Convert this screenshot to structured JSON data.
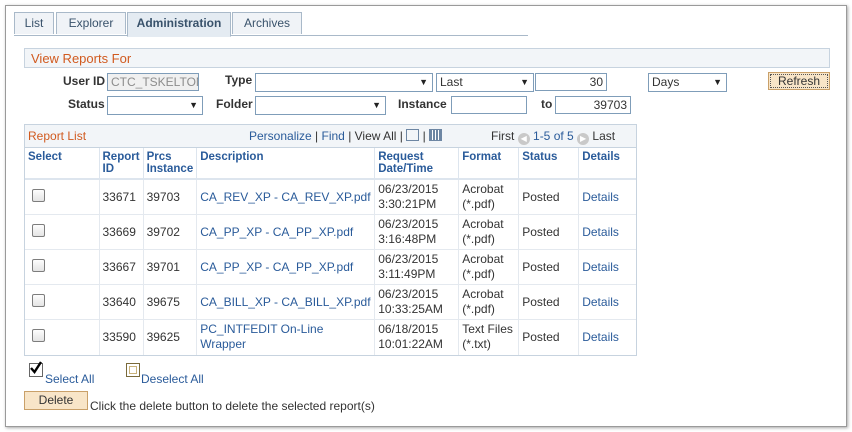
{
  "tabs": [
    {
      "label": "List",
      "active": false
    },
    {
      "label": "Explorer",
      "active": false
    },
    {
      "label": "Administration",
      "active": true
    },
    {
      "label": "Archives",
      "active": false
    }
  ],
  "filters": {
    "section_title": "View Reports For",
    "user_id_label": "User ID",
    "user_id_value": "CTC_TSKELTON",
    "type_label": "Type",
    "type_value": "",
    "last_value": "Last",
    "last_count": "30",
    "unit_value": "Days",
    "refresh_label": "Refresh",
    "status_label": "Status",
    "status_value": "",
    "folder_label": "Folder",
    "folder_value": "",
    "instance_label": "Instance",
    "instance_from": "",
    "to_label": "to",
    "instance_to": "39703"
  },
  "report_list": {
    "title": "Report List",
    "personalize": "Personalize",
    "find": "Find",
    "view_all": "View All",
    "first": "First",
    "range": "1-5 of 5",
    "last": "Last",
    "columns": [
      "Select",
      "Report ID",
      "Prcs Instance",
      "Description",
      "Request Date/Time",
      "Format",
      "Status",
      "Details"
    ],
    "rows": [
      {
        "report_id": "33671",
        "instance": "39703",
        "description": "CA_REV_XP - CA_REV_XP.pdf",
        "date": "06/23/2015",
        "time": "3:30:21PM",
        "format1": "Acrobat",
        "format2": "(*.pdf)",
        "status": "Posted",
        "details": "Details"
      },
      {
        "report_id": "33669",
        "instance": "39702",
        "description": "CA_PP_XP - CA_PP_XP.pdf",
        "date": "06/23/2015",
        "time": "3:16:48PM",
        "format1": "Acrobat",
        "format2": "(*.pdf)",
        "status": "Posted",
        "details": "Details"
      },
      {
        "report_id": "33667",
        "instance": "39701",
        "description": "CA_PP_XP - CA_PP_XP.pdf",
        "date": "06/23/2015",
        "time": "3:11:49PM",
        "format1": "Acrobat",
        "format2": "(*.pdf)",
        "status": "Posted",
        "details": "Details"
      },
      {
        "report_id": "33640",
        "instance": "39675",
        "description": "CA_BILL_XP - CA_BILL_XP.pdf",
        "date": "06/23/2015",
        "time": "10:33:25AM",
        "format1": "Acrobat",
        "format2": "(*.pdf)",
        "status": "Posted",
        "details": "Details"
      },
      {
        "report_id": "33590",
        "instance": "39625",
        "description": "PC_INTFEDIT On-Line Wrapper",
        "date": "06/18/2015",
        "time": "10:01:22AM",
        "format1": "Text Files",
        "format2": "(*.txt)",
        "status": "Posted",
        "details": "Details"
      }
    ]
  },
  "actions": {
    "select_all": "Select All",
    "deselect_all": "Deselect All",
    "delete_label": "Delete",
    "delete_hint": "Click the delete button to delete the selected report(s)"
  }
}
